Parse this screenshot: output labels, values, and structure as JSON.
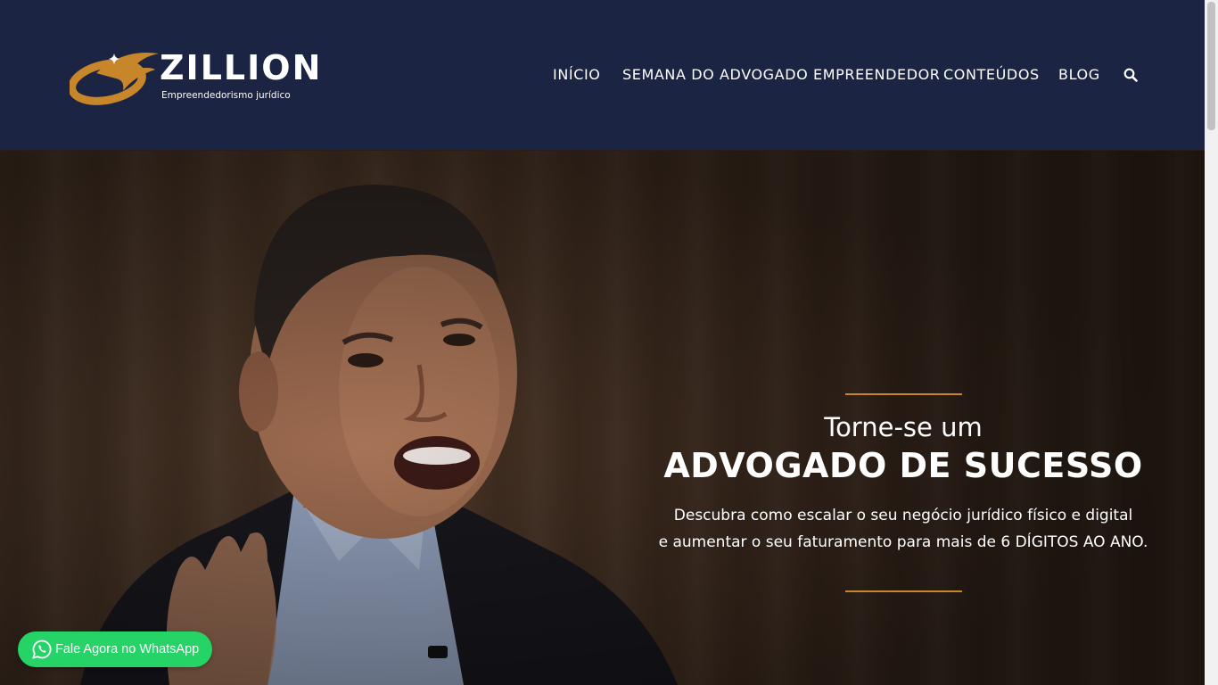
{
  "colors": {
    "header_bg": "#1b2442",
    "accent": "#c8862b",
    "whatsapp": "#25d366",
    "text": "#ffffff"
  },
  "logo": {
    "wordmark": "ZILLION",
    "tagline": "Empreendedorismo jurídico"
  },
  "nav": {
    "items": [
      {
        "label": "INÍCIO"
      },
      {
        "label": "SEMANA DO ADVOGADO EMPREENDEDOR"
      },
      {
        "label": "CONTEÚDOS"
      },
      {
        "label": "BLOG"
      }
    ],
    "search_icon": "search-icon"
  },
  "hero": {
    "pretitle": "Torne-se um",
    "title": "ADVOGADO DE SUCESSO",
    "description_line1": "Descubra como escalar o seu negócio jurídico físico e digital",
    "description_line2": "e aumentar o seu faturamento para mais de 6 DÍGITOS AO ANO."
  },
  "whatsapp": {
    "label": "Fale Agora no WhatsApp",
    "icon": "whatsapp-icon"
  }
}
